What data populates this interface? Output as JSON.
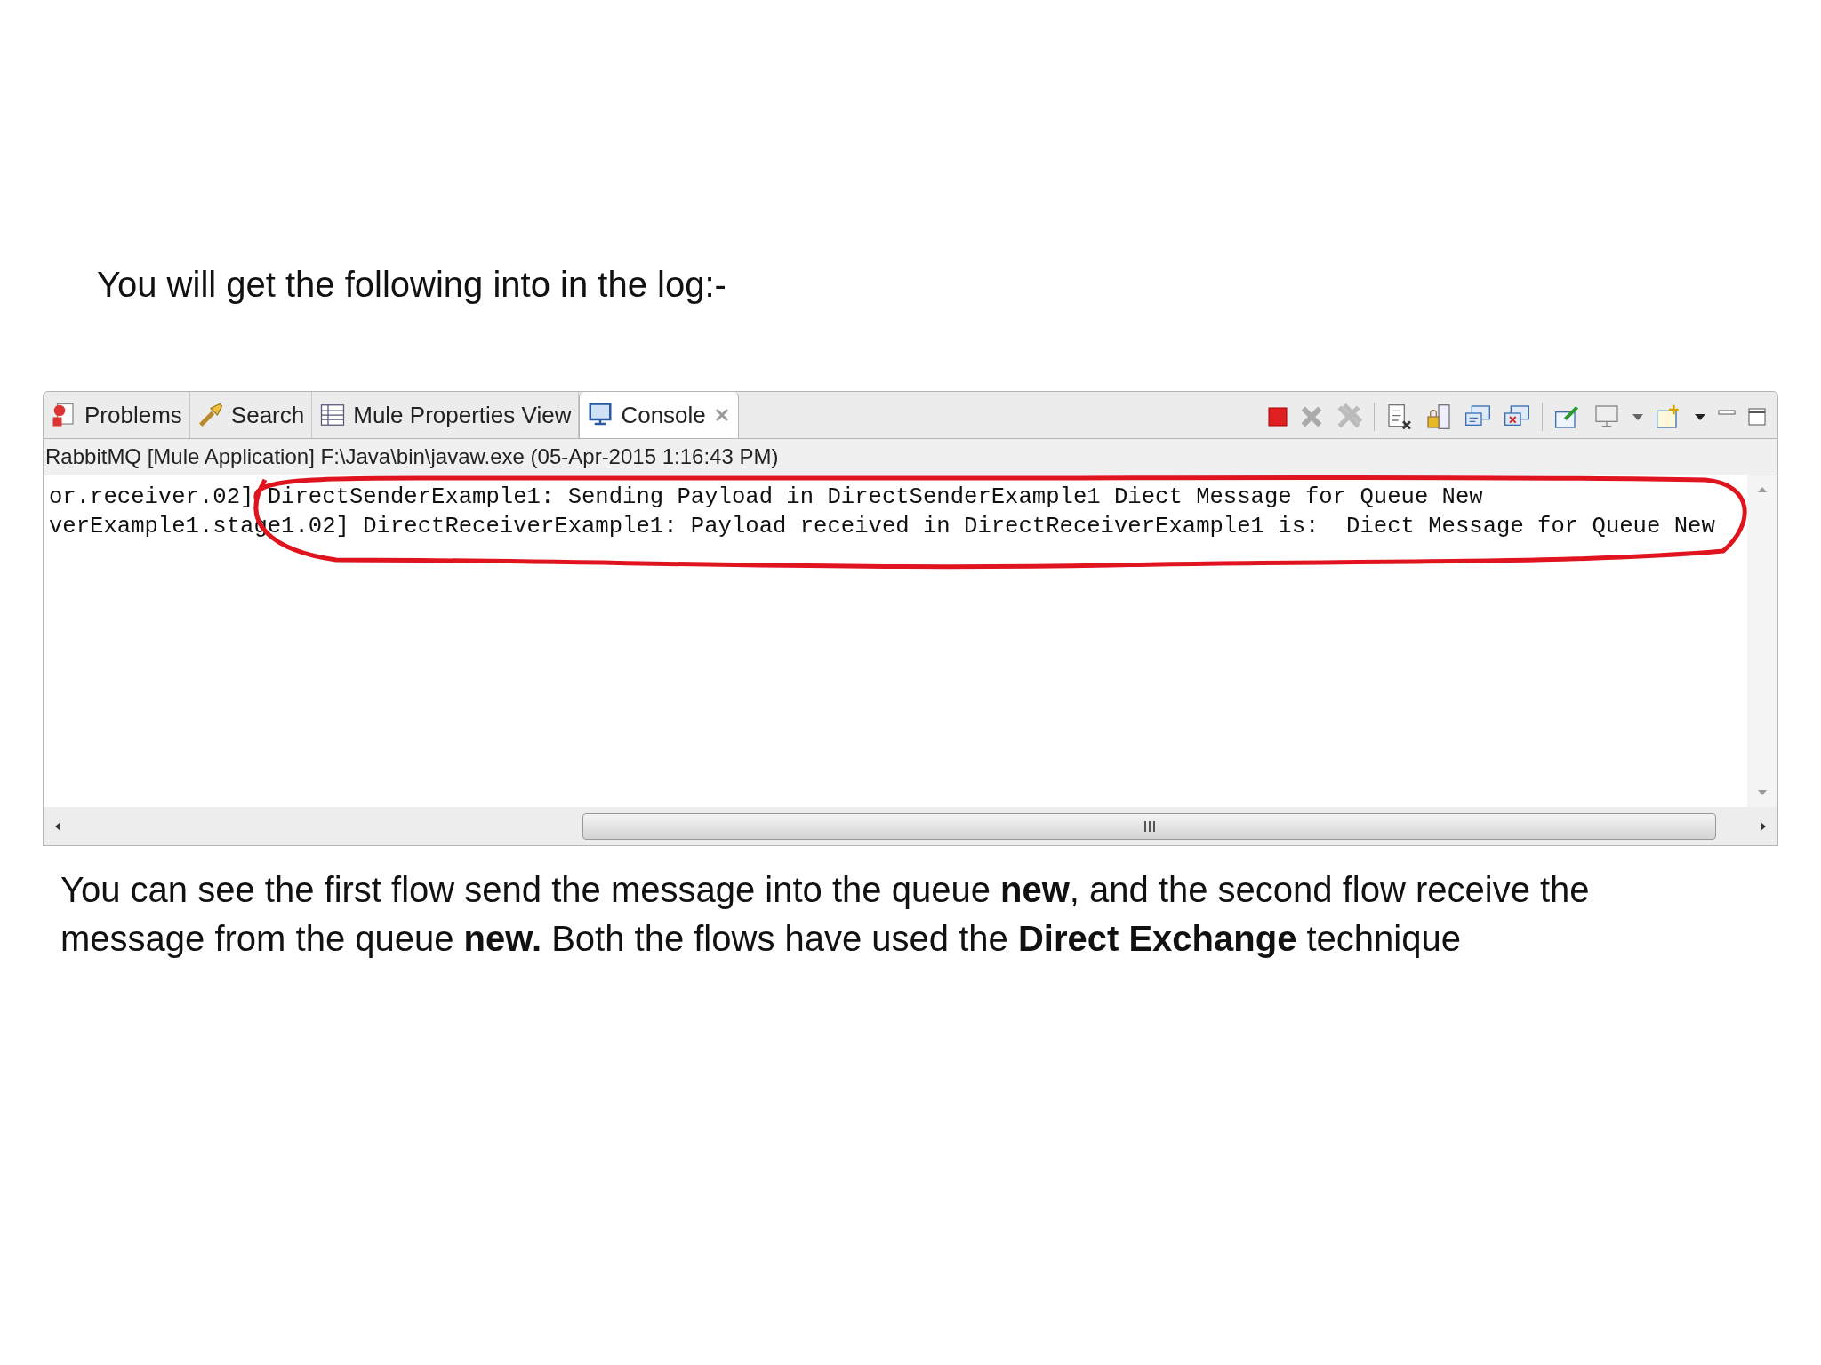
{
  "heading": "You will get the following into in the log:-",
  "console_view": {
    "tabs": [
      {
        "label": "Problems",
        "kind": "problems",
        "selected": false
      },
      {
        "label": "Search",
        "kind": "search",
        "selected": false
      },
      {
        "label": "Mule Properties View",
        "kind": "table",
        "selected": false
      },
      {
        "label": "Console",
        "kind": "console",
        "selected": true,
        "closable": true
      }
    ],
    "process_title": "RabbitMQ [Mule Application] F:\\Java\\bin\\javaw.exe (05-Apr-2015 1:16:43 PM)",
    "lines": [
      "or.receiver.02] DirectSenderExample1: Sending Payload in DirectSenderExample1 Diect Message for Queue New",
      "verExample1.stage1.02] DirectReceiverExample1: Payload received in DirectReceiverExample1 is:  Diect Message for Queue New"
    ],
    "annotation": {
      "kind": "ellipse",
      "color": "#e0141e"
    }
  },
  "paragraph": "You can see the first flow send the message into the queue **new**, and the second flow receive the message from the queue **new.** Both the flows have used the **Direct Exchange** technique"
}
